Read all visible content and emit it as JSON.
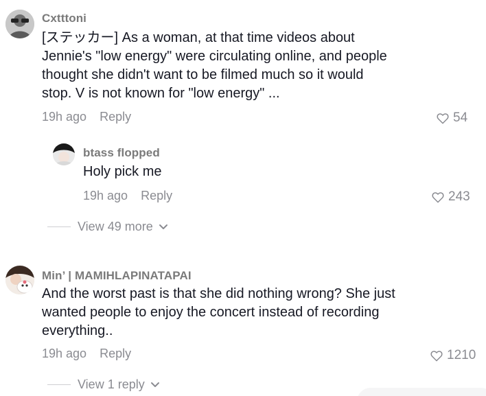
{
  "comments": [
    {
      "username": "Cxtttoni",
      "text": "[ステッカー] As a woman, at that time videos about\nJennie's \"low energy\" were circulating online, and people\nthought she didn't want to be filmed much so it would\nstop. V is not known for \"low energy\" ...",
      "time": "19h ago",
      "reply_label": "Reply",
      "likes": "54"
    },
    {
      "username": "btass flopped",
      "text": "Holy pick me",
      "time": "19h ago",
      "reply_label": "Reply",
      "likes": "243"
    },
    {
      "username": "Min’ | MAMIHLAPINATAPAI",
      "text": "And the worst past is that she did nothing wrong? She just\nwanted people to enjoy the concert instead of recording\neverything..",
      "time": "19h ago",
      "reply_label": "Reply",
      "likes": "1210"
    }
  ],
  "view_more": "View 49 more",
  "view_reply": "View 1 reply",
  "icons": {
    "like": "heart-outline-icon",
    "expand": "chevron-down-icon"
  },
  "colors": {
    "username": "#7a7a7a",
    "text": "#161823",
    "meta": "#8a8b91"
  }
}
